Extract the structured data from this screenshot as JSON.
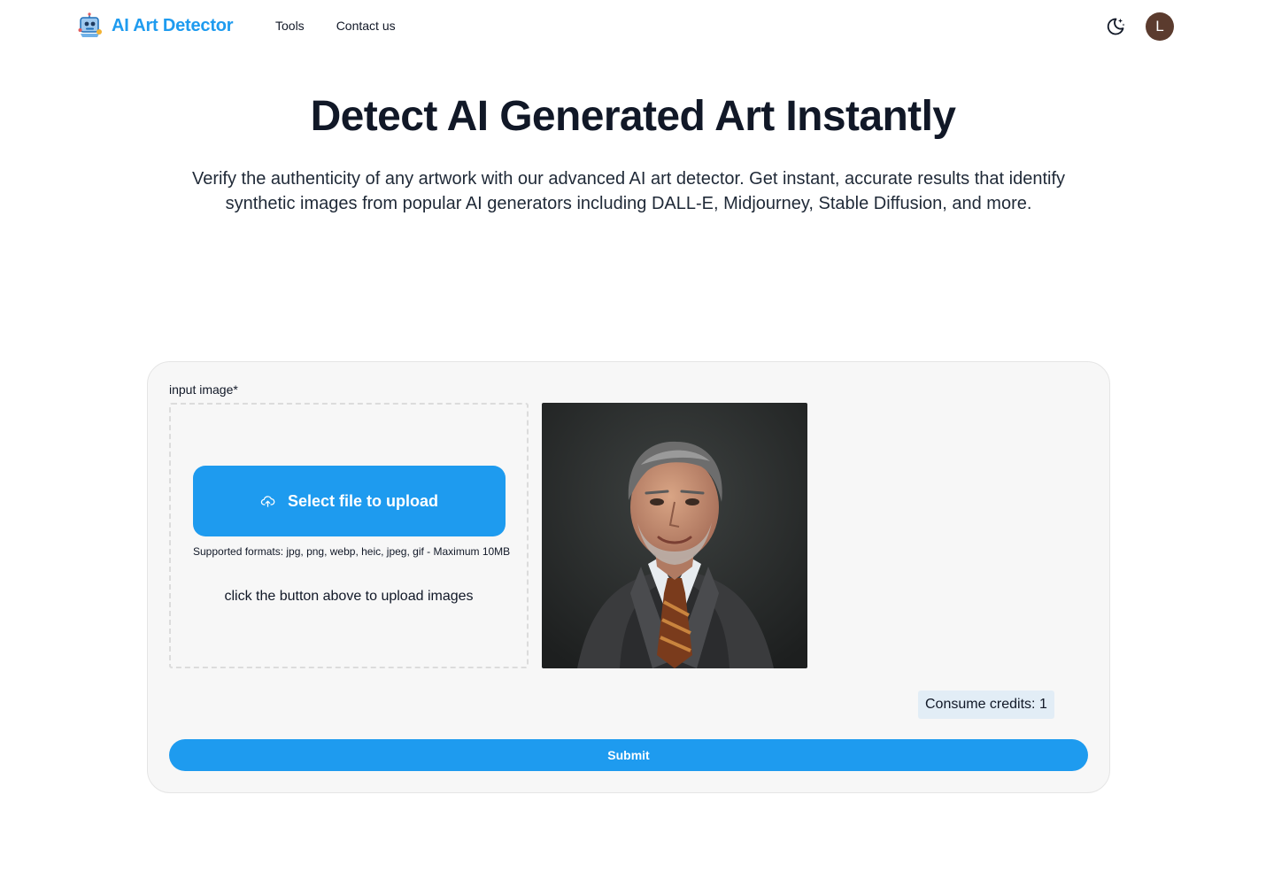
{
  "header": {
    "logo_text": "AI Art Detector",
    "logo_icon": "robot-painting-icon",
    "nav": [
      {
        "label": "Tools"
      },
      {
        "label": "Contact us"
      }
    ],
    "theme_icon": "moon-stars-icon",
    "avatar_initial": "L"
  },
  "hero": {
    "title": "Detect AI Generated Art Instantly",
    "subtitle": "Verify the authenticity of any artwork with our advanced AI art detector. Get instant, accurate results that identify synthetic images from popular AI generators including DALL-E, Midjourney, Stable Diffusion, and more."
  },
  "form": {
    "input_label": "input image*",
    "upload_button_label": "Select file to upload",
    "upload_icon": "cloud-upload-icon",
    "formats_text": "Supported formats: jpg, png, webp, heic, jpeg, gif - Maximum 10MB",
    "hint_text": "click the button above to upload images",
    "credits_text": "Consume credits: 1",
    "submit_label": "Submit"
  },
  "colors": {
    "brand": "#1e9bef",
    "avatar_bg": "#5b3b2e",
    "credits_bg": "#e2edf6",
    "card_bg": "#f7f7f7"
  }
}
